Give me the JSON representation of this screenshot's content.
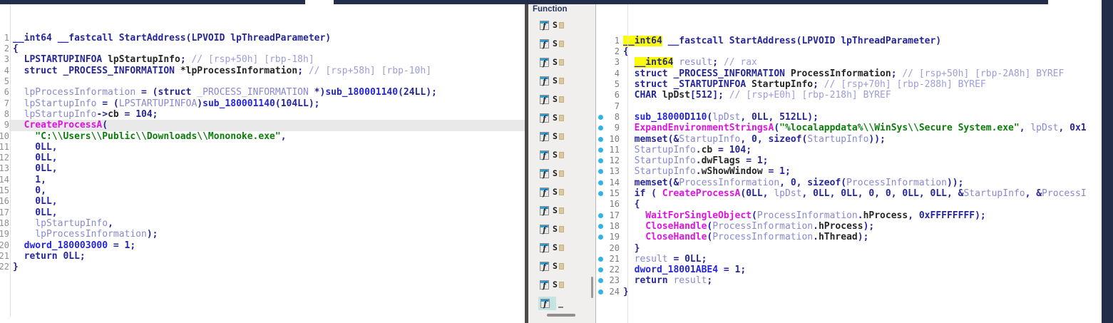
{
  "colors": {
    "window_edge": "#232e4b",
    "keyword_navy": "#26269b",
    "function_blue": "#2525d8",
    "import_magenta": "#df13df",
    "string_green": "#0b7d0b",
    "local_var_slate": "#8888cf",
    "comment_periwinkle": "#9c9cd9",
    "member_black": "#262626",
    "search_highlight_yellow": "#fcfc03",
    "line_highlight_gray": "#e9e9e9",
    "selection_teal": "#c5e3df",
    "address_dot_cyan": "#2fb4ea",
    "panel_bg": "#f1efed"
  },
  "left_pane": {
    "lines": [
      {
        "n": 1,
        "tokens": [
          [
            "p",
            "__int64 __fastcall StartAddress(LPVOID lpThreadParameter)"
          ]
        ]
      },
      {
        "n": 2,
        "tokens": [
          [
            "p",
            "{"
          ]
        ]
      },
      {
        "n": 3,
        "tokens": [
          [
            "p",
            "  LPSTARTUPINFOA "
          ],
          [
            "m",
            "lpStartupInfo"
          ],
          [
            "p",
            ";"
          ],
          [
            "c",
            " // [rsp+50h] [rbp-18h]"
          ]
        ]
      },
      {
        "n": 4,
        "tokens": [
          [
            "p",
            "  struct _PROCESS_INFORMATION "
          ],
          [
            "m",
            "*lpProcessInformation"
          ],
          [
            "p",
            ";"
          ],
          [
            "c",
            " // [rsp+58h] [rbp-10h]"
          ]
        ]
      },
      {
        "n": 5,
        "tokens": []
      },
      {
        "n": 6,
        "tokens": [
          [
            "v",
            "  lpProcessInformation"
          ],
          [
            "p",
            " = ("
          ],
          [
            "p",
            "struct "
          ],
          [
            "v",
            "_PROCESS_INFORMATION"
          ],
          [
            "p",
            " *)"
          ],
          [
            "f",
            "sub_180001140"
          ],
          [
            "p",
            "(24LL);"
          ]
        ]
      },
      {
        "n": 7,
        "tokens": [
          [
            "v",
            "  lpStartupInfo"
          ],
          [
            "p",
            " = ("
          ],
          [
            "v",
            "LPSTARTUPINFOA"
          ],
          [
            "p",
            ")"
          ],
          [
            "f",
            "sub_180001140"
          ],
          [
            "p",
            "(104LL);"
          ]
        ]
      },
      {
        "n": 8,
        "tokens": [
          [
            "v",
            "  lpStartupInfo"
          ],
          [
            "p",
            "->"
          ],
          [
            "m",
            "cb"
          ],
          [
            "p",
            " = 104;"
          ]
        ]
      },
      {
        "n": 9,
        "hl": true,
        "tokens": [
          [
            "i",
            "  CreateProcessA"
          ],
          [
            "p",
            "("
          ]
        ]
      },
      {
        "n": 10,
        "tokens": [
          [
            "s",
            "    \"C:\\\\Users\\\\Public\\\\Downloads\\\\Mononoke.exe\""
          ],
          [
            "p",
            ","
          ]
        ]
      },
      {
        "n": 11,
        "tokens": [
          [
            "p",
            "    0LL,"
          ]
        ]
      },
      {
        "n": 12,
        "tokens": [
          [
            "p",
            "    0LL,"
          ]
        ]
      },
      {
        "n": 13,
        "tokens": [
          [
            "p",
            "    0LL,"
          ]
        ]
      },
      {
        "n": 14,
        "tokens": [
          [
            "p",
            "    1,"
          ]
        ]
      },
      {
        "n": 15,
        "tokens": [
          [
            "p",
            "    0,"
          ]
        ]
      },
      {
        "n": 16,
        "tokens": [
          [
            "p",
            "    0LL,"
          ]
        ]
      },
      {
        "n": 17,
        "tokens": [
          [
            "p",
            "    0LL,"
          ]
        ]
      },
      {
        "n": 18,
        "tokens": [
          [
            "v",
            "    lpStartupInfo"
          ],
          [
            "p",
            ","
          ]
        ]
      },
      {
        "n": 19,
        "tokens": [
          [
            "v",
            "    lpProcessInformation"
          ],
          [
            "p",
            ");"
          ]
        ]
      },
      {
        "n": 20,
        "tokens": [
          [
            "f",
            "  dword_180003000"
          ],
          [
            "p",
            " = 1;"
          ]
        ]
      },
      {
        "n": 21,
        "tokens": [
          [
            "p",
            "  return 0LL;"
          ]
        ]
      },
      {
        "n": 22,
        "tokens": [
          [
            "p",
            "}"
          ]
        ]
      }
    ]
  },
  "functions_panel": {
    "header": "Function",
    "rows": [
      {
        "label": "S",
        "selected": false
      },
      {
        "label": "S",
        "selected": false
      },
      {
        "label": "S",
        "selected": false
      },
      {
        "label": "S",
        "selected": false
      },
      {
        "label": "S",
        "selected": false
      },
      {
        "label": "S",
        "selected": false
      },
      {
        "label": "S",
        "selected": false
      },
      {
        "label": "S",
        "selected": false
      },
      {
        "label": "S",
        "selected": false
      },
      {
        "label": "S",
        "selected": false
      },
      {
        "label": "S",
        "selected": false
      },
      {
        "label": "S",
        "selected": false
      },
      {
        "label": "S",
        "selected": false
      },
      {
        "label": "S",
        "selected": false
      },
      {
        "label": "S",
        "selected": false
      },
      {
        "label": "_",
        "selected": true
      }
    ]
  },
  "right_pane": {
    "lines": [
      {
        "n": 1,
        "dot": false,
        "tokens": [
          [
            "y",
            "__int64"
          ],
          [
            "p",
            " __fastcall StartAddress(LPVOID lpThreadParameter)"
          ]
        ]
      },
      {
        "n": 2,
        "dot": false,
        "tokens": [
          [
            "p",
            "{"
          ]
        ]
      },
      {
        "n": 3,
        "dot": false,
        "tokens": [
          [
            "p",
            "  "
          ],
          [
            "y",
            "__int64"
          ],
          [
            "p",
            " "
          ],
          [
            "v",
            "result"
          ],
          [
            "p",
            ";"
          ],
          [
            "c",
            " // rax"
          ]
        ]
      },
      {
        "n": 4,
        "dot": false,
        "tokens": [
          [
            "p",
            "  struct _PROCESS_INFORMATION "
          ],
          [
            "m",
            "ProcessInformation"
          ],
          [
            "p",
            ";"
          ],
          [
            "c",
            " // [rsp+50h] [rbp-2A8h] BYREF"
          ]
        ]
      },
      {
        "n": 5,
        "dot": false,
        "tokens": [
          [
            "p",
            "  struct _STARTUPINFOA "
          ],
          [
            "m",
            "StartupInfo"
          ],
          [
            "p",
            ";"
          ],
          [
            "c",
            " // [rsp+70h] [rbp-288h] BYREF"
          ]
        ]
      },
      {
        "n": 6,
        "dot": false,
        "tokens": [
          [
            "p",
            "  CHAR "
          ],
          [
            "m",
            "lpDst"
          ],
          [
            "p",
            "[512];"
          ],
          [
            "c",
            " // [rsp+E0h] [rbp-218h] BYREF"
          ]
        ]
      },
      {
        "n": 7,
        "dot": false,
        "tokens": []
      },
      {
        "n": 8,
        "dot": true,
        "tokens": [
          [
            "f",
            "  sub_18000D110"
          ],
          [
            "p",
            "("
          ],
          [
            "v",
            "lpDst"
          ],
          [
            "p",
            ", 0LL, 512LL);"
          ]
        ]
      },
      {
        "n": 9,
        "dot": true,
        "tokens": [
          [
            "i",
            "  ExpandEnvironmentStringsA"
          ],
          [
            "p",
            "("
          ],
          [
            "s",
            "\"%localappdata%\\\\WinSys\\\\Secure System.exe\""
          ],
          [
            "p",
            ", "
          ],
          [
            "v",
            "lpDst"
          ],
          [
            "p",
            ", 0x1"
          ]
        ]
      },
      {
        "n": 10,
        "dot": true,
        "tokens": [
          [
            "p",
            "  memset(&"
          ],
          [
            "v",
            "StartupInfo"
          ],
          [
            "p",
            ", 0, sizeof("
          ],
          [
            "v",
            "StartupInfo"
          ],
          [
            "p",
            "));"
          ]
        ]
      },
      {
        "n": 11,
        "dot": true,
        "tokens": [
          [
            "v",
            "  StartupInfo"
          ],
          [
            "p",
            "."
          ],
          [
            "m",
            "cb"
          ],
          [
            "p",
            " = 104;"
          ]
        ]
      },
      {
        "n": 12,
        "dot": true,
        "tokens": [
          [
            "v",
            "  StartupInfo"
          ],
          [
            "p",
            "."
          ],
          [
            "m",
            "dwFlags"
          ],
          [
            "p",
            " = 1;"
          ]
        ]
      },
      {
        "n": 13,
        "dot": true,
        "tokens": [
          [
            "v",
            "  StartupInfo"
          ],
          [
            "p",
            "."
          ],
          [
            "m",
            "wShowWindow"
          ],
          [
            "p",
            " = 1;"
          ]
        ]
      },
      {
        "n": 14,
        "dot": true,
        "tokens": [
          [
            "p",
            "  memset(&"
          ],
          [
            "v",
            "ProcessInformation"
          ],
          [
            "p",
            ", 0, sizeof("
          ],
          [
            "v",
            "ProcessInformation"
          ],
          [
            "p",
            "));"
          ]
        ]
      },
      {
        "n": 15,
        "dot": true,
        "tokens": [
          [
            "p",
            "  if ( "
          ],
          [
            "i",
            "CreateProcessA"
          ],
          [
            "p",
            "(0LL, "
          ],
          [
            "v",
            "lpDst"
          ],
          [
            "p",
            ", 0LL, 0LL, 0, 0, 0LL, 0LL, &"
          ],
          [
            "v",
            "StartupInfo"
          ],
          [
            "p",
            ", &"
          ],
          [
            "v",
            "ProcessI"
          ]
        ]
      },
      {
        "n": 16,
        "dot": false,
        "tokens": [
          [
            "p",
            "  {"
          ]
        ]
      },
      {
        "n": 17,
        "dot": true,
        "tokens": [
          [
            "i",
            "    WaitForSingleObject"
          ],
          [
            "p",
            "("
          ],
          [
            "v",
            "ProcessInformation"
          ],
          [
            "p",
            "."
          ],
          [
            "m",
            "hProcess"
          ],
          [
            "p",
            ", 0xFFFFFFFF);"
          ]
        ]
      },
      {
        "n": 18,
        "dot": true,
        "tokens": [
          [
            "i",
            "    CloseHandle"
          ],
          [
            "p",
            "("
          ],
          [
            "v",
            "ProcessInformation"
          ],
          [
            "p",
            "."
          ],
          [
            "m",
            "hProcess"
          ],
          [
            "p",
            ");"
          ]
        ]
      },
      {
        "n": 19,
        "dot": true,
        "tokens": [
          [
            "i",
            "    CloseHandle"
          ],
          [
            "p",
            "("
          ],
          [
            "v",
            "ProcessInformation"
          ],
          [
            "p",
            "."
          ],
          [
            "m",
            "hThread"
          ],
          [
            "p",
            ");"
          ]
        ]
      },
      {
        "n": 20,
        "dot": false,
        "tokens": [
          [
            "p",
            "  }"
          ]
        ]
      },
      {
        "n": 21,
        "dot": true,
        "tokens": [
          [
            "v",
            "  result"
          ],
          [
            "p",
            " = 0LL;"
          ]
        ]
      },
      {
        "n": 22,
        "dot": true,
        "tokens": [
          [
            "f",
            "  dword_18001ABE4"
          ],
          [
            "p",
            " = 1;"
          ]
        ]
      },
      {
        "n": 23,
        "dot": true,
        "tokens": [
          [
            "p",
            "  return "
          ],
          [
            "v",
            "result"
          ],
          [
            "p",
            ";"
          ]
        ]
      },
      {
        "n": 24,
        "dot": true,
        "tokens": [
          [
            "p",
            "}"
          ]
        ]
      }
    ]
  }
}
